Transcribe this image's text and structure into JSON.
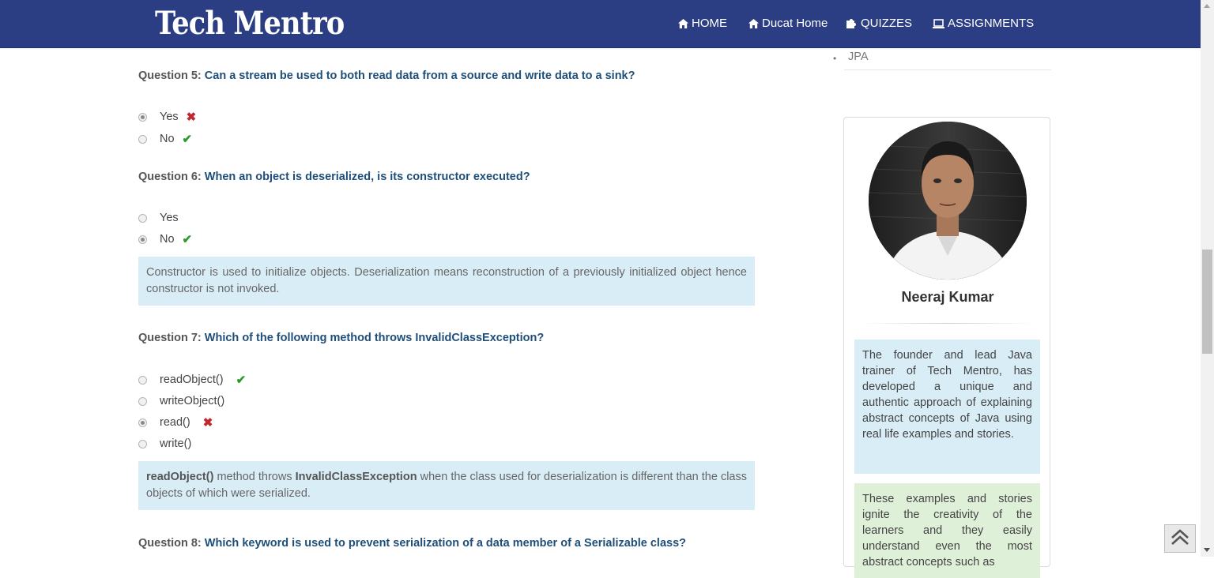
{
  "header": {
    "brand": "Tech Mentro",
    "nav": [
      {
        "label": "HOME",
        "icon": "home-icon"
      },
      {
        "label": "Ducat Home",
        "icon": "home-icon"
      },
      {
        "label": "QUIZZES",
        "icon": "puzzle-icon"
      },
      {
        "label": "ASSIGNMENTS",
        "icon": "laptop-icon"
      }
    ]
  },
  "sidebar": {
    "list_item": "JPA",
    "profile": {
      "name": "Neeraj Kumar",
      "bio1": "The founder and lead Java trainer of Tech Mentro, has developed a unique and authentic approach of explaining abstract concepts of Java using real life examples and stories.",
      "bio2": "These examples and stories ignite the creativity of the learners and they easily understand even the most abstract concepts such as"
    }
  },
  "questions": [
    {
      "number": "Question 5:",
      "text": "Can a stream be used to both read data from a source and write data to a sink?",
      "options": [
        {
          "label": "Yes",
          "selected": true,
          "mark": "wrong"
        },
        {
          "label": "No",
          "selected": false,
          "mark": "correct"
        }
      ]
    },
    {
      "number": "Question 6:",
      "text": "When an object is deserialized, is its constructor executed?",
      "options": [
        {
          "label": "Yes",
          "selected": false,
          "mark": ""
        },
        {
          "label": "No",
          "selected": true,
          "mark": "correct"
        }
      ],
      "explanation": "Constructor is used to initialize objects. Deserialization means reconstruction of a previously initialized object hence constructor is not invoked."
    },
    {
      "number": "Question 7:",
      "text": "Which of the following method throws InvalidClassException?",
      "options": [
        {
          "label": "readObject()",
          "selected": false,
          "mark": "correct"
        },
        {
          "label": "writeObject()",
          "selected": false,
          "mark": ""
        },
        {
          "label": "read()",
          "selected": true,
          "mark": "wrong"
        },
        {
          "label": "write()",
          "selected": false,
          "mark": ""
        }
      ],
      "explanation": {
        "bold1": "readObject()",
        "text1": " method throws ",
        "bold2": "InvalidClassException",
        "text2": " when the class used for deserialization is different than the class objects of which were serialized."
      }
    },
    {
      "number": "Question 8:",
      "text": "Which keyword is used to prevent serialization of a data member of a Serializable class?"
    }
  ],
  "colors": {
    "navbar": "#2c3e83",
    "question_text": "#1f4e79",
    "explain_bg": "#d9edf7",
    "bio2_bg": "#dff0d8",
    "correct": "#2a9a2a",
    "wrong": "#c0282d"
  },
  "marks": {
    "correct": "✔",
    "wrong": "✖"
  }
}
